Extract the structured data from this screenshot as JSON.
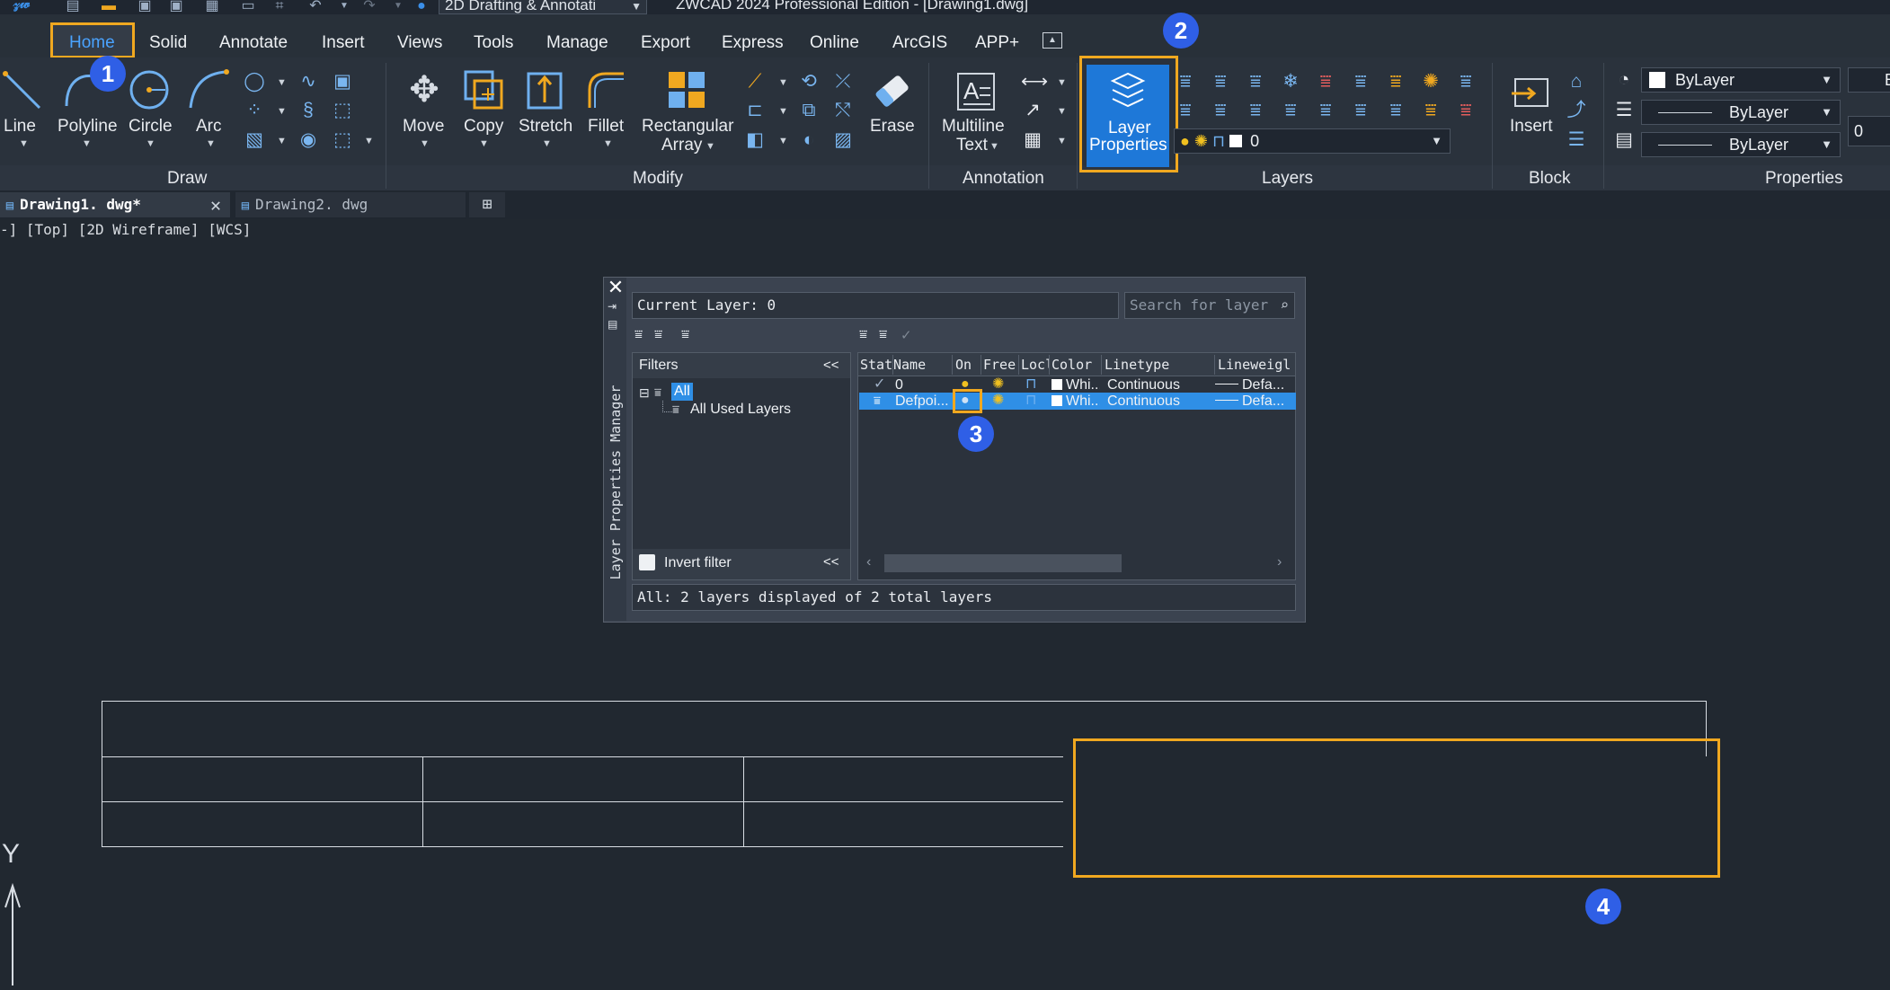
{
  "window": {
    "workspace": "2D Drafting & Annotati",
    "app_title": "ZWCAD 2024 Professional Edition - [Drawing1.dwg]"
  },
  "menu_tabs": [
    {
      "label": "Home",
      "active": true
    },
    {
      "label": "Solid"
    },
    {
      "label": "Annotate"
    },
    {
      "label": "Insert"
    },
    {
      "label": "Views"
    },
    {
      "label": "Tools"
    },
    {
      "label": "Manage"
    },
    {
      "label": "Export"
    },
    {
      "label": "Express"
    },
    {
      "label": "Online"
    },
    {
      "label": "ArcGIS"
    },
    {
      "label": "APP+"
    }
  ],
  "ribbon": {
    "draw": {
      "line": "Line",
      "polyline": "Polyline",
      "circle": "Circle",
      "arc": "Arc"
    },
    "modify": {
      "move": "Move",
      "copy": "Copy",
      "stretch": "Stretch",
      "fillet": "Fillet",
      "rect_array_1": "Rectangular",
      "rect_array_2": "Array",
      "erase": "Erase"
    },
    "annotation": {
      "mtext_1": "Multiline",
      "mtext_2": "Text"
    },
    "layers": {
      "layer_props_1": "Layer",
      "layer_props_2": "Properties",
      "current_layer": "0"
    },
    "block": {
      "insert": "Insert"
    },
    "properties": {
      "color": "ByLayer",
      "linetype": "ByLayer",
      "lineweight": "ByLayer",
      "edge_value": "0",
      "edge_letter": "B"
    },
    "panels": [
      "Draw",
      "Modify",
      "Annotation",
      "Layers",
      "Block",
      "Properties"
    ]
  },
  "file_tabs": [
    {
      "label": "Drawing1. dwg*",
      "active": true
    },
    {
      "label": "Drawing2. dwg",
      "active": false
    }
  ],
  "viewport_label": "-] [Top] [2D Wireframe] [WCS]",
  "dialog": {
    "side_title": "Layer Properties Manager",
    "current_layer": "Current Layer: 0",
    "search_placeholder": "Search for layer",
    "filters_title": "Filters",
    "collapse": "<<",
    "tree": {
      "all": "All",
      "used": "All Used Layers"
    },
    "invert_filter": "Invert filter",
    "columns": [
      "Stat",
      "Name",
      "On",
      "Free",
      "Locl",
      "Color",
      "Linetype",
      "Lineweigl"
    ],
    "layers": [
      {
        "name": "0",
        "color": "Whi...",
        "linetype": "Continuous",
        "lineweight": "Defa..."
      },
      {
        "name": "Defpoi...",
        "color": "Whi...",
        "linetype": "Continuous",
        "lineweight": "Defa..."
      }
    ],
    "status": "All: 2 layers displayed of 2 total layers"
  },
  "badges": [
    "1",
    "2",
    "3",
    "4"
  ],
  "axis_label": "Y",
  "colors": {
    "accent": "#1e78d8",
    "highlight": "#f0a820",
    "badge": "#2f5fe6",
    "canvas": "#212830"
  }
}
